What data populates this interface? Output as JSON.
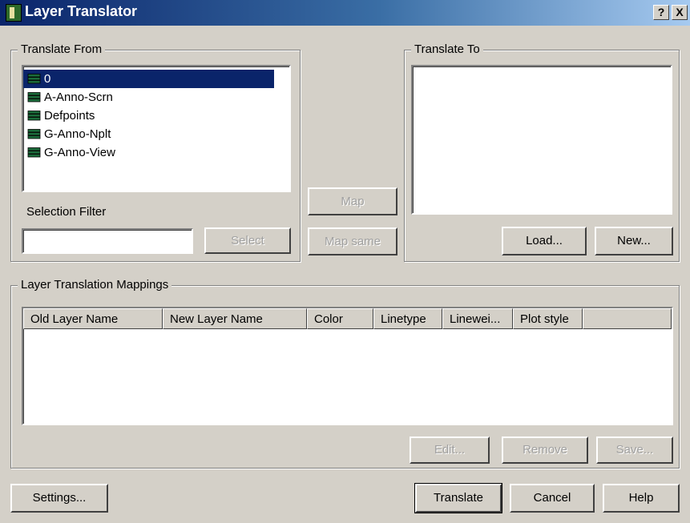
{
  "window": {
    "title": "Layer Translator",
    "help_label": "?",
    "close_label": "X"
  },
  "translate_from": {
    "legend": "Translate From",
    "layers": [
      {
        "name": "0",
        "selected": true
      },
      {
        "name": "A-Anno-Scrn",
        "selected": false
      },
      {
        "name": "Defpoints",
        "selected": false
      },
      {
        "name": "G-Anno-Nplt",
        "selected": false
      },
      {
        "name": "G-Anno-View",
        "selected": false
      }
    ],
    "filter_label": "Selection Filter",
    "filter_value": "",
    "select_label": "Select"
  },
  "middle": {
    "map_label": "Map",
    "map_same_label": "Map same"
  },
  "translate_to": {
    "legend": "Translate To",
    "load_label": "Load...",
    "new_label": "New..."
  },
  "mappings": {
    "legend": "Layer Translation Mappings",
    "columns": [
      "Old Layer Name",
      "New Layer Name",
      "Color",
      "Linetype",
      "Linewei...",
      "Plot style"
    ],
    "edit_label": "Edit...",
    "remove_label": "Remove",
    "save_label": "Save..."
  },
  "footer": {
    "settings_label": "Settings...",
    "translate_label": "Translate",
    "cancel_label": "Cancel",
    "help_label": "Help"
  },
  "colors": {
    "title_start": "#0a246a",
    "title_end": "#a6caf0",
    "selection": "#0a246a",
    "face": "#d4d0c8",
    "layer_icon": "#1b6b3a"
  }
}
